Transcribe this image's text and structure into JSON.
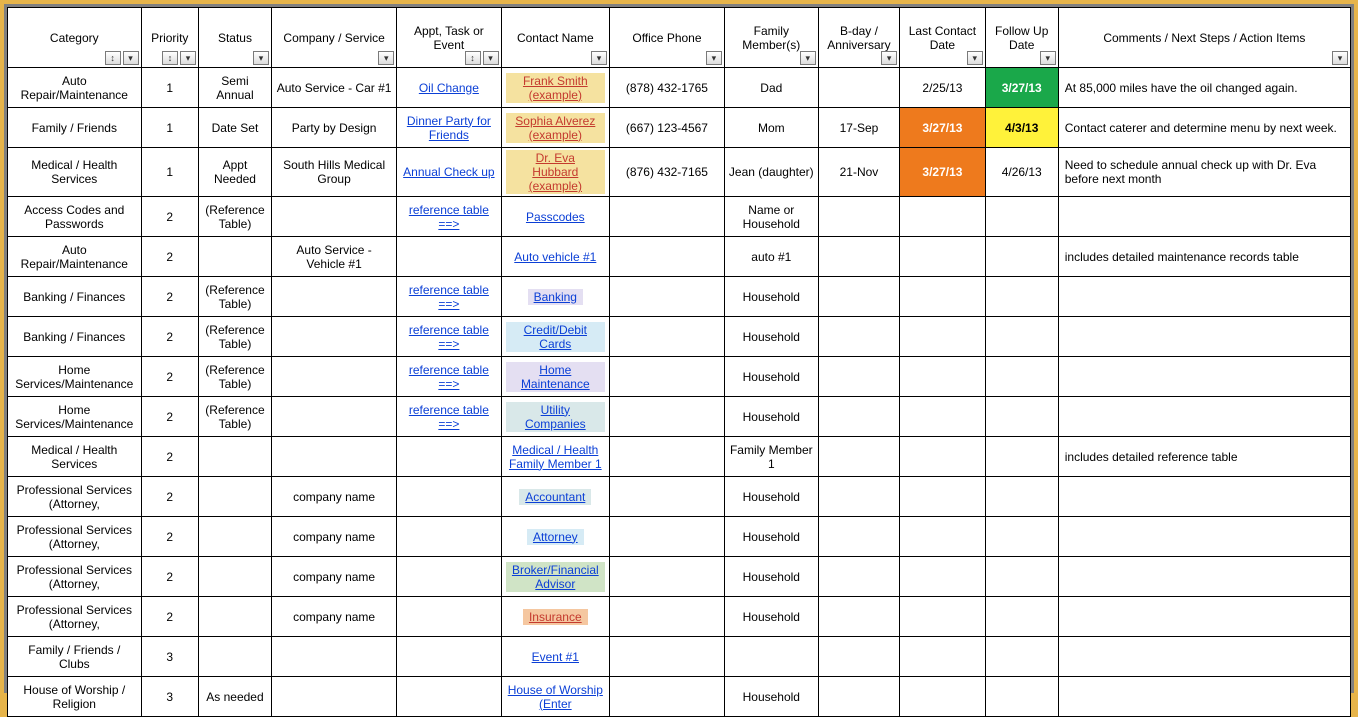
{
  "headers": [
    {
      "label": "Category",
      "sort": true,
      "filter": true
    },
    {
      "label": "Priority",
      "sort": true,
      "filter": true
    },
    {
      "label": "Status",
      "sort": false,
      "filter": true
    },
    {
      "label": "Company / Service",
      "sort": false,
      "filter": true
    },
    {
      "label": "Appt, Task or Event",
      "sort": true,
      "filter": true
    },
    {
      "label": "Contact Name",
      "sort": false,
      "filter": true
    },
    {
      "label": "Office Phone",
      "sort": false,
      "filter": true
    },
    {
      "label": "Family Member(s)",
      "sort": false,
      "filter": true
    },
    {
      "label": "B-day / Anniversary",
      "sort": false,
      "filter": true
    },
    {
      "label": "Last Contact Date",
      "sort": false,
      "filter": true
    },
    {
      "label": "Follow Up Date",
      "sort": false,
      "filter": true
    },
    {
      "label": "Comments / Next Steps / Action Items",
      "sort": false,
      "filter": true
    }
  ],
  "rows": [
    {
      "category": "Auto Repair/Maintenance",
      "priority": "1",
      "status": "Semi Annual",
      "company": "Auto Service - Car #1",
      "appt": {
        "text": "Oil Change",
        "link": true
      },
      "contact": {
        "text": "Frank Smith (example)",
        "link": true,
        "red": true,
        "hl": "khaki"
      },
      "phone": "(878) 432-1765",
      "family": "Dad",
      "bday": "",
      "last": {
        "text": "2/25/13"
      },
      "follow": {
        "text": "3/27/13",
        "bg": "green"
      },
      "comments": "At 85,000 miles have the oil changed again."
    },
    {
      "category": "Family / Friends",
      "priority": "1",
      "status": "Date Set",
      "company": "Party by Design",
      "appt": {
        "text": "Dinner Party for Friends",
        "link": true
      },
      "contact": {
        "text": "Sophia Alverez (example)",
        "link": true,
        "red": true,
        "hl": "khaki"
      },
      "phone": "(667) 123-4567",
      "family": "Mom",
      "bday": "17-Sep",
      "last": {
        "text": "3/27/13",
        "bg": "orange"
      },
      "follow": {
        "text": "4/3/13",
        "bg": "yellow"
      },
      "comments": "Contact caterer and determine menu by next week."
    },
    {
      "category": "Medical / Health Services",
      "priority": "1",
      "status": "Appt Needed",
      "company": "South Hills Medical Group",
      "appt": {
        "text": "Annual Check up",
        "link": true
      },
      "contact": {
        "text": "Dr. Eva Hubbard (example)",
        "link": true,
        "red": true,
        "hl": "khaki"
      },
      "phone": "(876) 432-7165",
      "family": "Jean (daughter)",
      "bday": "21-Nov",
      "last": {
        "text": "3/27/13",
        "bg": "orange"
      },
      "follow": {
        "text": "4/26/13"
      },
      "comments": "Need to schedule annual check up with Dr. Eva before next month"
    },
    {
      "category": "Access Codes and Passwords",
      "priority": "2",
      "status": "(Reference Table)",
      "company": "",
      "appt": {
        "text": "reference table ==>",
        "link": true
      },
      "contact": {
        "text": "Passcodes ",
        "link": true
      },
      "phone": "",
      "family": "Name or Household",
      "bday": "",
      "last": {
        "text": ""
      },
      "follow": {
        "text": ""
      },
      "comments": ""
    },
    {
      "category": "Auto Repair/Maintenance",
      "priority": "2",
      "status": "",
      "company": "Auto Service - Vehicle #1",
      "appt": {
        "text": ""
      },
      "contact": {
        "text": "Auto vehicle #1",
        "link": true
      },
      "phone": "",
      "family": "auto #1",
      "bday": "",
      "last": {
        "text": ""
      },
      "follow": {
        "text": ""
      },
      "comments": "includes detailed maintenance records table"
    },
    {
      "category": "Banking / Finances",
      "priority": "2",
      "status": "(Reference Table)",
      "company": "",
      "appt": {
        "text": "reference table ==>",
        "link": true
      },
      "contact": {
        "text": "Banking ",
        "link": true,
        "hl": "lav"
      },
      "phone": "",
      "family": "Household",
      "bday": "",
      "last": {
        "text": ""
      },
      "follow": {
        "text": ""
      },
      "comments": ""
    },
    {
      "category": "Banking / Finances",
      "priority": "2",
      "status": "(Reference Table)",
      "company": "",
      "appt": {
        "text": "reference table ==>",
        "link": true
      },
      "contact": {
        "text": "Credit/Debit Cards ",
        "link": true,
        "hl": "blue"
      },
      "phone": "",
      "family": "Household",
      "bday": "",
      "last": {
        "text": ""
      },
      "follow": {
        "text": ""
      },
      "comments": ""
    },
    {
      "category": "Home Services/Maintenance",
      "priority": "2",
      "status": "(Reference Table)",
      "company": "",
      "appt": {
        "text": "reference table ==>",
        "link": true
      },
      "contact": {
        "text": "Home Maintenance ",
        "link": true,
        "hl": "lav"
      },
      "phone": "",
      "family": "Household",
      "bday": "",
      "last": {
        "text": ""
      },
      "follow": {
        "text": ""
      },
      "comments": ""
    },
    {
      "category": "Home Services/Maintenance",
      "priority": "2",
      "status": "(Reference Table)",
      "company": "",
      "appt": {
        "text": "reference table ==>",
        "link": true
      },
      "contact": {
        "text": "Utility Companies",
        "link": true,
        "hl": "mint"
      },
      "phone": "",
      "family": "Household",
      "bday": "",
      "last": {
        "text": ""
      },
      "follow": {
        "text": ""
      },
      "comments": ""
    },
    {
      "category": "Medical / Health Services",
      "priority": "2",
      "status": "",
      "company": "",
      "appt": {
        "text": ""
      },
      "contact": {
        "text": "Medical / Health Family Member 1",
        "link": true
      },
      "phone": "",
      "family": "Family Member 1",
      "bday": "",
      "last": {
        "text": ""
      },
      "follow": {
        "text": ""
      },
      "comments": "includes detailed reference table"
    },
    {
      "category": "Professional Services (Attorney,",
      "priority": "2",
      "status": "",
      "company": "company name",
      "appt": {
        "text": ""
      },
      "contact": {
        "text": "Accountant ",
        "link": true,
        "hl": "mint"
      },
      "phone": "",
      "family": "Household",
      "bday": "",
      "last": {
        "text": ""
      },
      "follow": {
        "text": ""
      },
      "comments": ""
    },
    {
      "category": "Professional Services (Attorney,",
      "priority": "2",
      "status": "",
      "company": "company name",
      "appt": {
        "text": ""
      },
      "contact": {
        "text": "Attorney ",
        "link": true,
        "hl": "blue"
      },
      "phone": "",
      "family": "Household",
      "bday": "",
      "last": {
        "text": ""
      },
      "follow": {
        "text": ""
      },
      "comments": ""
    },
    {
      "category": "Professional Services (Attorney,",
      "priority": "2",
      "status": "",
      "company": "company name",
      "appt": {
        "text": ""
      },
      "contact": {
        "text": "Broker/Financial Advisor ",
        "link": true,
        "hl": "green2"
      },
      "phone": "",
      "family": "Household",
      "bday": "",
      "last": {
        "text": ""
      },
      "follow": {
        "text": ""
      },
      "comments": ""
    },
    {
      "category": "Professional Services (Attorney,",
      "priority": "2",
      "status": "",
      "company": "company name",
      "appt": {
        "text": ""
      },
      "contact": {
        "text": "Insurance ",
        "link": true,
        "red": true,
        "hl": "peach"
      },
      "phone": "",
      "family": "Household",
      "bday": "",
      "last": {
        "text": ""
      },
      "follow": {
        "text": ""
      },
      "comments": ""
    },
    {
      "category": "Family / Friends / Clubs",
      "priority": "3",
      "status": "",
      "company": "",
      "appt": {
        "text": ""
      },
      "contact": {
        "text": "Event #1",
        "link": true
      },
      "phone": "",
      "family": "",
      "bday": "",
      "last": {
        "text": ""
      },
      "follow": {
        "text": ""
      },
      "comments": ""
    },
    {
      "category": "House of Worship / Religion",
      "priority": "3",
      "status": "As needed",
      "company": "",
      "appt": {
        "text": ""
      },
      "contact": {
        "text": "House of Worship (Enter ",
        "link": true
      },
      "phone": "",
      "family": "Household",
      "bday": "",
      "last": {
        "text": ""
      },
      "follow": {
        "text": ""
      },
      "comments": ""
    }
  ]
}
